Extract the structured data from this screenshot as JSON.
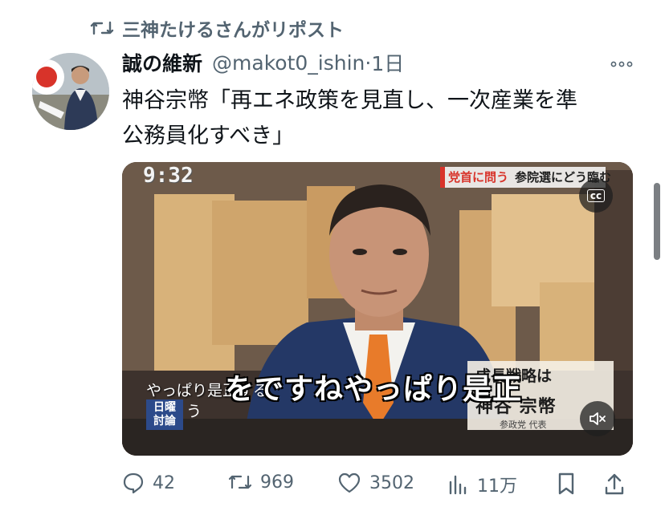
{
  "repost": {
    "text": "三神たけるさんがリポスト"
  },
  "tweet": {
    "display_name": "誠の維新",
    "handle": "@makot0_ishin",
    "separator": "·",
    "time": "1日",
    "body_line1": "神谷宗幣「再エネ政策を見直し、一次産業を準",
    "body_line2": "公務員化すべき」"
  },
  "video": {
    "clock": "9:32",
    "banner_label": "党首に問う",
    "banner_text": "参院選にどう臨む",
    "cc_label": "cc",
    "small_caption": "やっぱり是正する",
    "show_logo_line1": "日曜",
    "show_logo_line2": "討論",
    "small_caption2": "う",
    "big_subtitle": "をですねやっぱり是正",
    "lower_third_top": "成長戦略は",
    "lower_third_name": "神谷 宗幣",
    "lower_third_role": "参政党 代表",
    "mute_icon": "volume-muted-icon"
  },
  "stats": {
    "replies": "42",
    "reposts": "969",
    "likes": "3502",
    "views": "11万"
  },
  "colors": {
    "text": "#0f1419",
    "secondary": "#536471",
    "accent_orange": "#e87b2a"
  }
}
